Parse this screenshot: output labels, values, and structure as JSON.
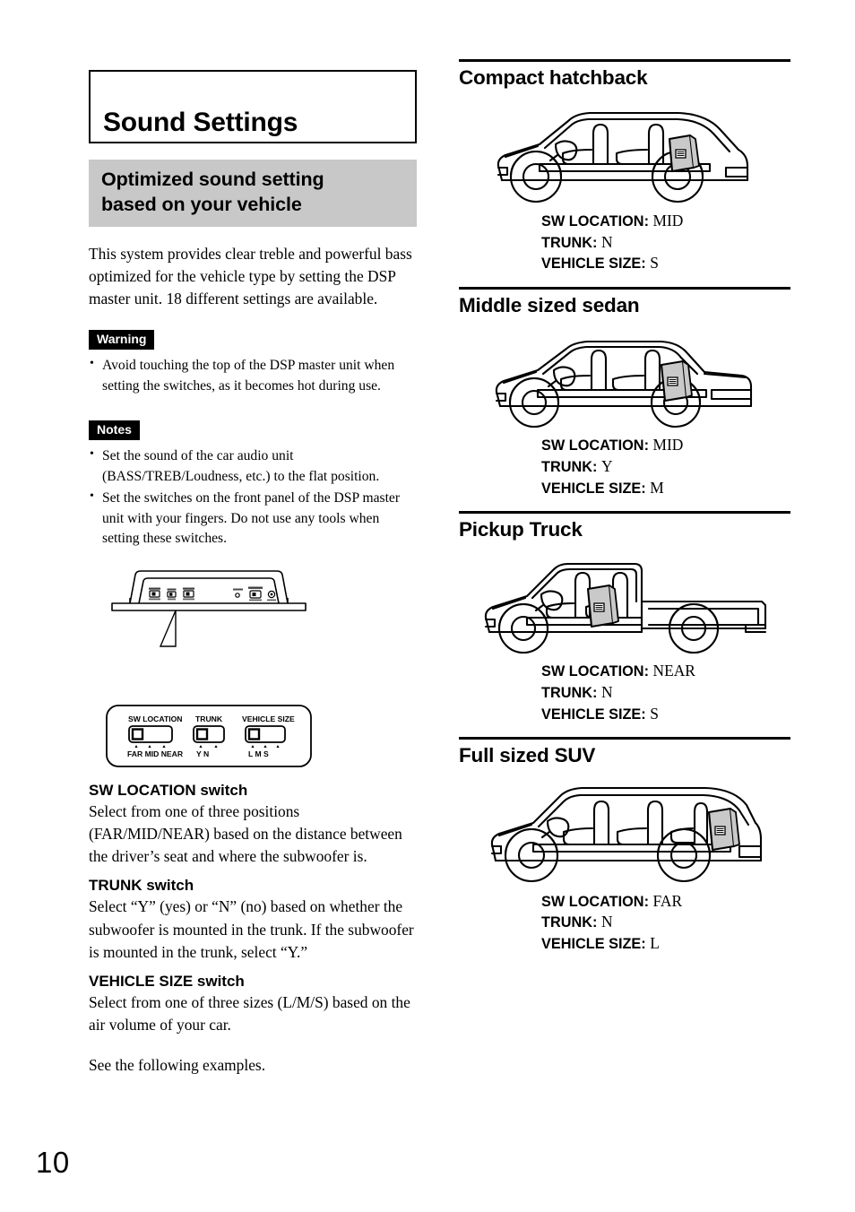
{
  "page": {
    "number": "10"
  },
  "chapter": {
    "title": "Sound Settings"
  },
  "section": {
    "heading_line1": "Optimized sound setting",
    "heading_line2": "based on your vehicle",
    "intro": "This system provides clear treble and powerful bass optimized for the vehicle type by setting the DSP master unit. 18 different settings are available."
  },
  "warning": {
    "badge": "Warning",
    "items": [
      "Avoid touching the top of the DSP master unit when setting the switches, as it becomes hot during use."
    ]
  },
  "notes": {
    "badge": "Notes",
    "items": [
      "Set the sound of the car audio unit (BASS/TREB/Loudness, etc.) to the flat position.",
      "Set the switches on the front panel of the DSP master unit with your fingers. Do not use any tools when setting these switches."
    ]
  },
  "dsp_figure": {
    "switches": [
      {
        "name": "SW LOCATION",
        "positions": [
          "FAR",
          "MID",
          "NEAR"
        ]
      },
      {
        "name": "TRUNK",
        "positions": [
          "Y",
          "N"
        ]
      },
      {
        "name": "VEHICLE SIZE",
        "positions": [
          "L",
          "M",
          "S"
        ]
      }
    ]
  },
  "switch_descriptions": [
    {
      "title": "SW LOCATION switch",
      "text": "Select from one of three positions (FAR/MID/NEAR) based on the distance between the driver’s seat and where the subwoofer is."
    },
    {
      "title": "TRUNK switch",
      "text": "Select “Y” (yes) or “N” (no) based on whether the subwoofer is mounted in the trunk. If the subwoofer is mounted in the trunk, select “Y.”"
    },
    {
      "title": "VEHICLE SIZE switch",
      "text": "Select from one of three sizes (L/M/S) based on the air volume of your car."
    }
  ],
  "see_examples": "See the following examples.",
  "spec_labels": {
    "sw_location": "SW LOCATION",
    "trunk": "TRUNK",
    "vehicle_size": "VEHICLE SIZE",
    "separator": ": "
  },
  "vehicles": [
    {
      "title": "Compact hatchback",
      "art": "hatchback",
      "sw_location": "MID",
      "trunk": "N",
      "vehicle_size": "S"
    },
    {
      "title": "Middle sized sedan",
      "art": "sedan",
      "sw_location": "MID",
      "trunk": "Y",
      "vehicle_size": "M"
    },
    {
      "title": "Pickup Truck",
      "art": "pickup",
      "sw_location": "NEAR",
      "trunk": "N",
      "vehicle_size": "S"
    },
    {
      "title": "Full sized SUV",
      "art": "suv",
      "sw_location": "FAR",
      "trunk": "N",
      "vehicle_size": "L"
    }
  ],
  "colors": {
    "heading_band": "#c8c8c8",
    "badge_bg": "#000000",
    "subwoofer_fill": "#c9c9c9",
    "text": "#000000"
  }
}
